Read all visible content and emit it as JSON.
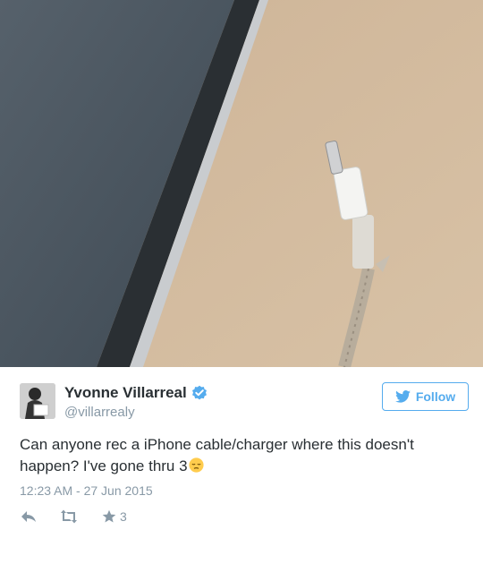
{
  "colors": {
    "accent": "#55acee",
    "name": "#292f33",
    "muted": "#8899a6",
    "action_icon": "#aab8c2"
  },
  "media": {
    "icon": "photo-cable-image"
  },
  "tweet": {
    "author_name": "Yvonne Villarreal",
    "handle": "@villarrealy",
    "verified_icon": "verified-badge-icon",
    "follow_label": "Follow",
    "text": "Can anyone rec a iPhone cable/charger where this doesn't happen? I've gone thru 3",
    "emoji_icon": "pensive-face-emoji",
    "timestamp": "12:23 AM - 27 Jun 2015",
    "favorite_count": "3"
  }
}
